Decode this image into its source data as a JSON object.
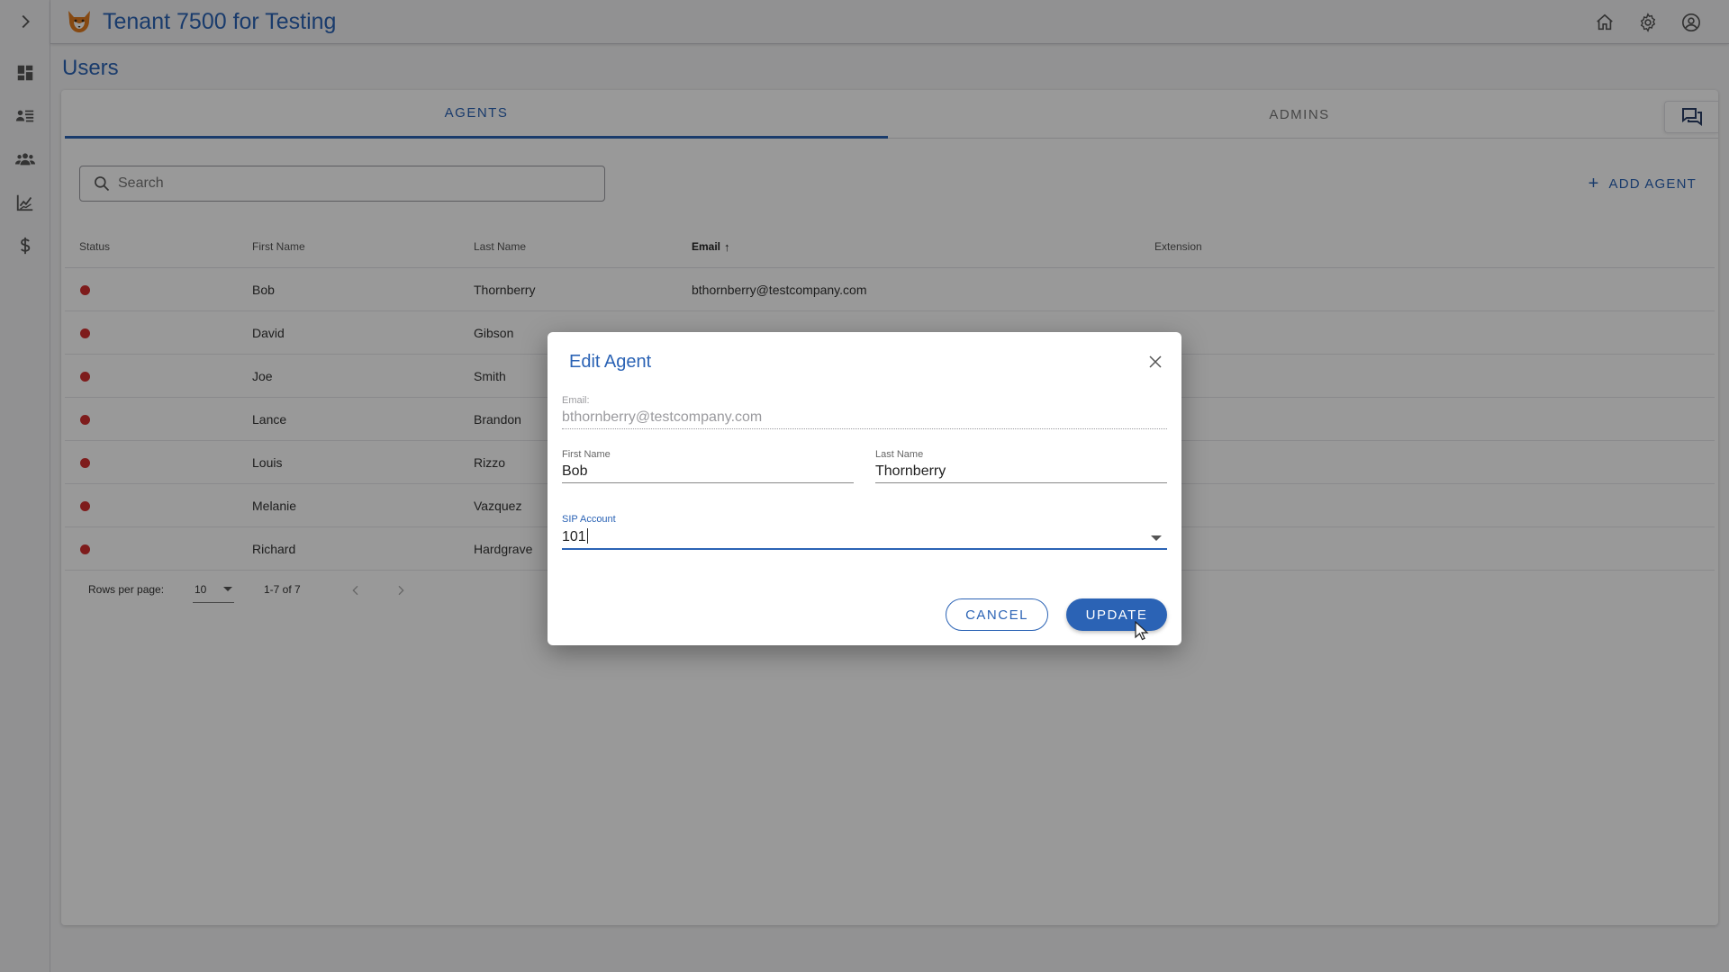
{
  "app": {
    "title": "Tenant 7500 for Testing"
  },
  "page": {
    "title": "Users"
  },
  "tabs": [
    {
      "label": "AGENTS",
      "active": true
    },
    {
      "label": "ADMINS",
      "active": false
    }
  ],
  "search": {
    "placeholder": "Search",
    "value": ""
  },
  "actions": {
    "add_agent_label": "ADD AGENT"
  },
  "table": {
    "columns": [
      "Status",
      "First Name",
      "Last Name",
      "Email",
      "Extension"
    ],
    "sorted_column": "Email",
    "sort_direction": "ascending",
    "rows": [
      {
        "status": "offline",
        "first_name": "Bob",
        "last_name": "Thornberry",
        "email": "bthornberry@testcompany.com",
        "extension": ""
      },
      {
        "status": "offline",
        "first_name": "David",
        "last_name": "Gibson",
        "email": "",
        "extension": ""
      },
      {
        "status": "offline",
        "first_name": "Joe",
        "last_name": "Smith",
        "email": "",
        "extension": ""
      },
      {
        "status": "offline",
        "first_name": "Lance",
        "last_name": "Brandon",
        "email": "",
        "extension": ""
      },
      {
        "status": "offline",
        "first_name": "Louis",
        "last_name": "Rizzo",
        "email": "",
        "extension": ""
      },
      {
        "status": "offline",
        "first_name": "Melanie",
        "last_name": "Vazquez",
        "email": "",
        "extension": ""
      },
      {
        "status": "offline",
        "first_name": "Richard",
        "last_name": "Hardgrave",
        "email": "",
        "extension": ""
      }
    ]
  },
  "pagination": {
    "rows_per_page_label": "Rows per page:",
    "rows_per_page": "10",
    "range": "1-7 of 7"
  },
  "dialog": {
    "title": "Edit Agent",
    "email_label": "Email:",
    "email_value": "bthornberry@testcompany.com",
    "first_name_label": "First Name",
    "first_name_value": "Bob",
    "last_name_label": "Last Name",
    "last_name_value": "Thornberry",
    "sip_label": "SIP Account",
    "sip_value": "101",
    "cancel_label": "CANCEL",
    "update_label": "UPDATE"
  },
  "colors": {
    "primary": "#2b63b5",
    "status_offline": "#d32f2f"
  },
  "icons": {
    "rail": [
      "chevron-right-icon",
      "dashboard-icon",
      "queue-list-icon",
      "users-group-icon",
      "analytics-chart-icon",
      "billing-dollar-icon"
    ],
    "topbar": [
      "home-icon",
      "gear-icon",
      "account-circle-icon"
    ]
  }
}
